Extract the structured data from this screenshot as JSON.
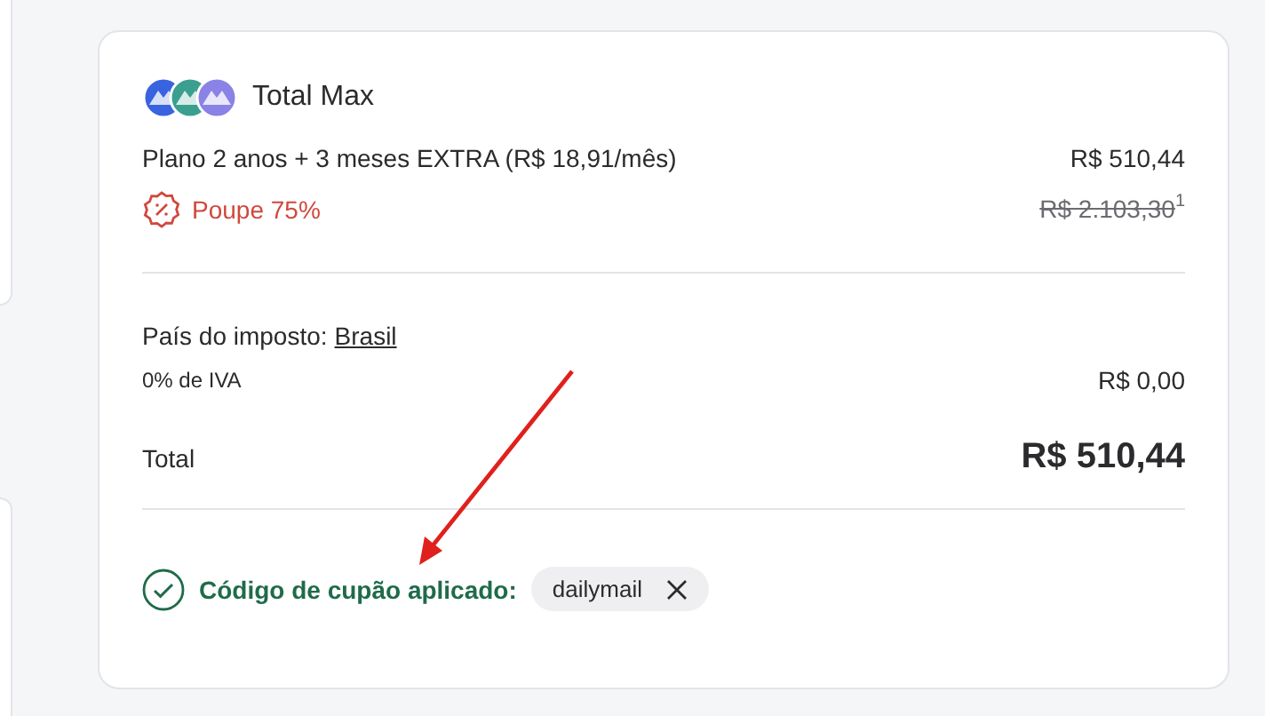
{
  "product": {
    "name": "Total Max"
  },
  "plan": {
    "label": "Plano 2 anos + 3 meses EXTRA (R$ 18,91/mês)",
    "price": "R$ 510,44"
  },
  "savings": {
    "label": "Poupe 75%",
    "old_price": "R$ 2.103,30",
    "footnote": "1"
  },
  "tax": {
    "label": "País do imposto:",
    "country": "Brasil",
    "vat_label": "0% de IVA",
    "vat_amount": "R$ 0,00"
  },
  "total": {
    "label": "Total",
    "amount": "R$ 510,44"
  },
  "coupon": {
    "label": "Código de cupão aplicado:",
    "code": "dailymail"
  }
}
